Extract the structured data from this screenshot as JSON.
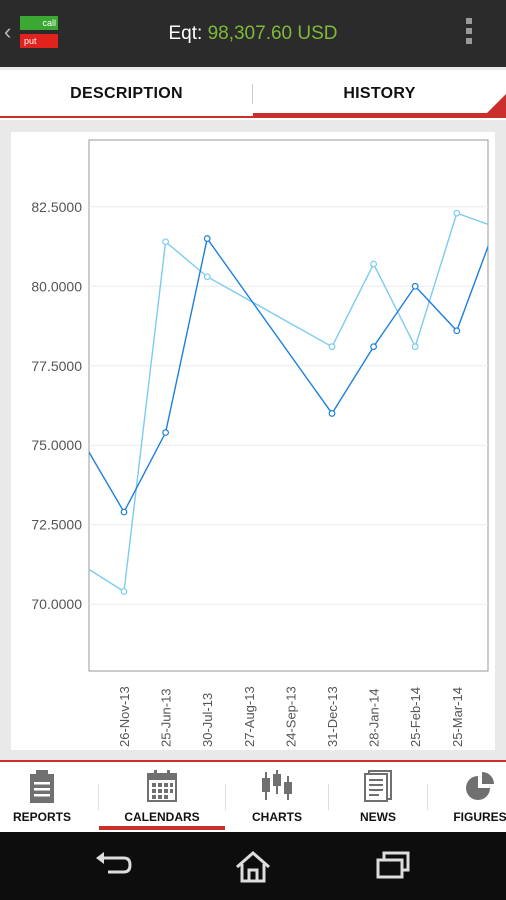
{
  "app": {
    "logo": {
      "call_label": "call",
      "put_label": "put"
    },
    "equity_label": "Eqt:",
    "equity_value": "98,307.60 USD",
    "colors": {
      "equity_value": "#7fb83a",
      "accent": "#c9302c"
    }
  },
  "tabs": [
    {
      "label": "DESCRIPTION",
      "active": false
    },
    {
      "label": "HISTORY",
      "active": true
    }
  ],
  "chart_data": {
    "type": "line",
    "categories": [
      "26-Nov-13",
      "25-Jun-13",
      "30-Jul-13",
      "27-Aug-13",
      "24-Sep-13",
      "31-Dec-13",
      "28-Jan-14",
      "25-Feb-14",
      "25-Mar-14"
    ],
    "ytick_labels": [
      "82.5000",
      "80.0000",
      "77.5000",
      "75.0000",
      "72.5000",
      "70.0000"
    ],
    "ylim": [
      67.9,
      84.6
    ],
    "grid": true,
    "series": [
      {
        "color": "#1e7fdc",
        "points": [
          [
            -0.85,
            74.8
          ],
          [
            0,
            72.9
          ],
          [
            1,
            75.4
          ],
          [
            2,
            81.5
          ],
          [
            5,
            76.0
          ],
          [
            6,
            78.1
          ],
          [
            7,
            80.0
          ],
          [
            8,
            78.6
          ],
          [
            8.85,
            81.6
          ]
        ]
      },
      {
        "color": "#7ccbf0",
        "points": [
          [
            -0.85,
            71.1
          ],
          [
            0,
            70.4
          ],
          [
            1,
            81.4
          ],
          [
            2,
            80.3
          ],
          [
            5,
            78.1
          ],
          [
            6,
            80.7
          ],
          [
            7,
            78.1
          ],
          [
            8,
            82.3
          ],
          [
            8.85,
            81.9
          ]
        ]
      }
    ]
  },
  "bottom_nav": [
    {
      "label": "REPORTS",
      "icon": "reports-icon",
      "active": false
    },
    {
      "label": "CALENDARS",
      "icon": "calendar-icon",
      "active": true
    },
    {
      "label": "CHARTS",
      "icon": "candlestick-chart-icon",
      "active": false
    },
    {
      "label": "NEWS",
      "icon": "news-icon",
      "active": false
    },
    {
      "label": "FIGURES",
      "icon": "pie-chart-icon",
      "active": false
    }
  ],
  "system_nav": {
    "icons": [
      "back-icon",
      "home-icon",
      "recent-apps-icon"
    ]
  }
}
